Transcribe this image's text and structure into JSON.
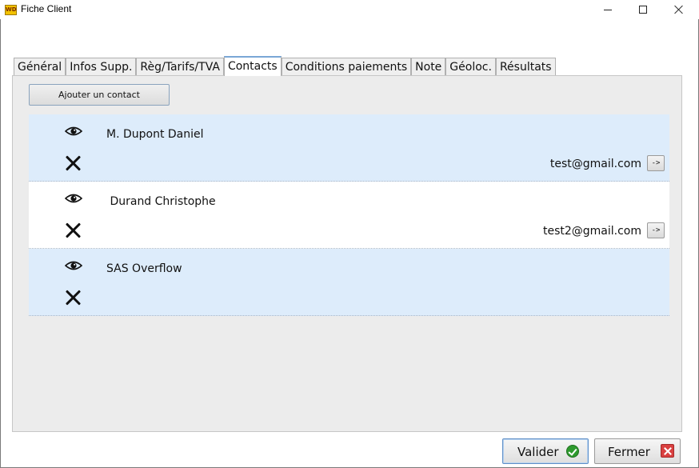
{
  "window": {
    "title": "Fiche Client",
    "icon": "windev-app-icon",
    "controls": [
      "minimize-icon",
      "maximize-icon",
      "close-icon"
    ]
  },
  "tabs": [
    {
      "label": "Général",
      "active": false
    },
    {
      "label": "Infos Supp.",
      "active": false
    },
    {
      "label": "Règ/Tarifs/TVA",
      "active": false
    },
    {
      "label": "Contacts",
      "active": true
    },
    {
      "label": "Conditions paiements",
      "active": false
    },
    {
      "label": "Note",
      "active": false
    },
    {
      "label": "Géoloc.",
      "active": false
    },
    {
      "label": "Résultats",
      "active": false
    }
  ],
  "contacts_tab": {
    "add_button_label": "Ajouter un contact",
    "contacts": [
      {
        "name": "M. Dupont Daniel",
        "email": "test@gmail.com",
        "goto_label": "->",
        "view_icon": "eye-icon",
        "delete_icon": "delete-x-icon"
      },
      {
        "name": " Durand Christophe",
        "email": "test2@gmail.com",
        "goto_label": "->",
        "view_icon": "eye-icon",
        "delete_icon": "delete-x-icon"
      },
      {
        "name": "SAS Overflow",
        "email": "",
        "goto_label": "",
        "view_icon": "eye-icon",
        "delete_icon": "delete-x-icon"
      }
    ]
  },
  "footer": {
    "validate_label": "Valider",
    "close_label": "Fermer"
  },
  "colors": {
    "row_highlight": "#ddecfb",
    "row_plain": "#ffffff",
    "panel_bg": "#ececec",
    "ok_green": "#2e9a2e",
    "cancel_red": "#d94040",
    "active_tab_border": "#7aa7d6"
  }
}
